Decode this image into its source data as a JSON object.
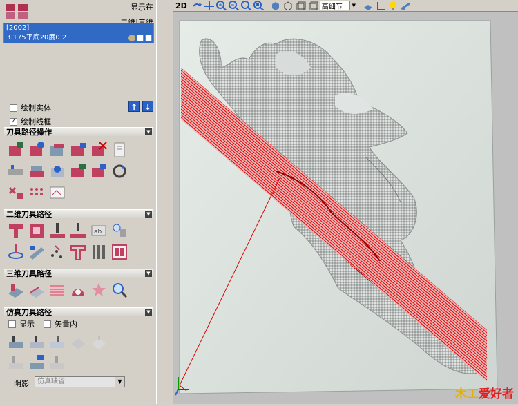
{
  "header": {
    "display_label": "显示在",
    "dim_label": "二维|三维"
  },
  "toolpath_list": {
    "id": "[2002]",
    "tool": "3.175平底20度0.2"
  },
  "options": {
    "draw_solid": "绘制实体",
    "draw_wireframe": "绘制线框"
  },
  "sections": {
    "toolpath_ops": "刀具路径操作",
    "toolpath_2d": "二维刀具路径",
    "toolpath_3d": "三维刀具路径",
    "simulation": "仿真刀具路径"
  },
  "sim": {
    "show": "显示",
    "in_vector": "矢量内",
    "shadow": "阴影",
    "shadow_value": "仿真缺省"
  },
  "toolbar": {
    "mode": "2D",
    "detail": "高细节"
  },
  "colors": {
    "accent": "#316ac5",
    "toolpath": "#e00000"
  },
  "logo": {
    "part1": "木工",
    "part2": "爱好者"
  }
}
